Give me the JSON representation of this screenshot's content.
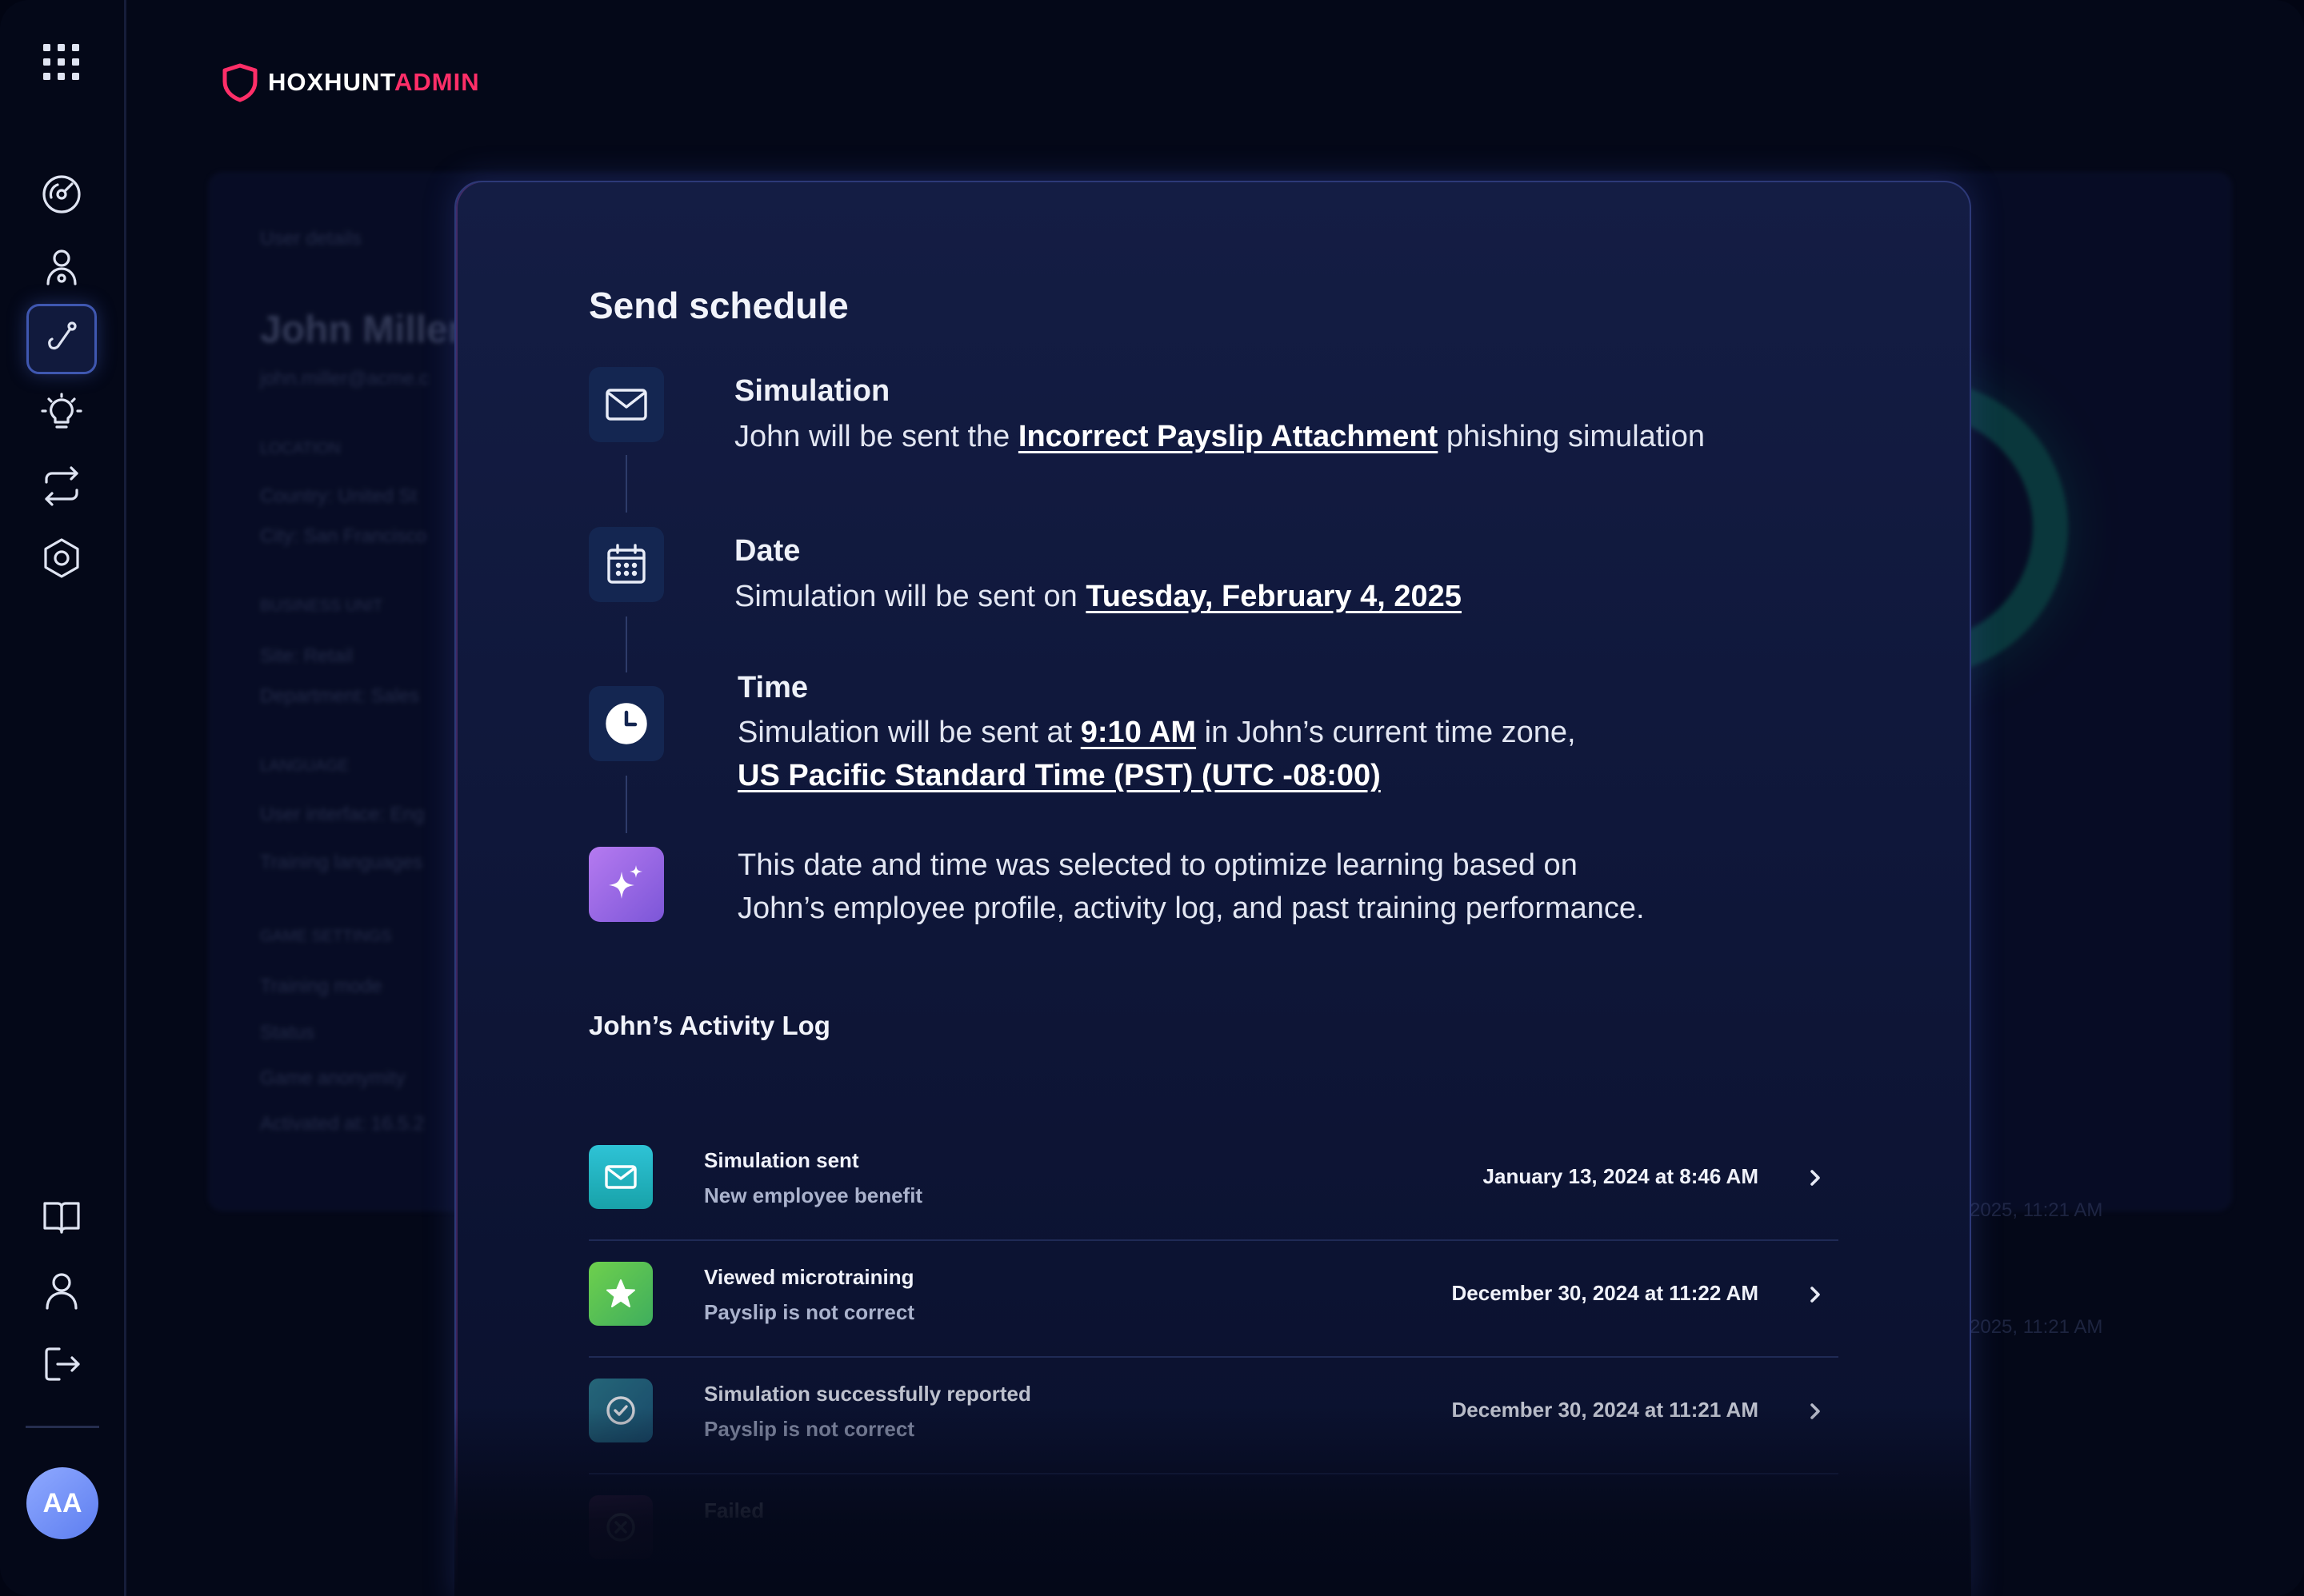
{
  "brand": {
    "name_part1": "HOXHUNT",
    "name_part2": "ADMIN",
    "accent": "#ff2e68"
  },
  "sidebar": {
    "icons": [
      "apps-grid-icon",
      "dashboard-icon",
      "user-settings-icon",
      "phishing-hook-icon",
      "lightbulb-icon",
      "sync-icon",
      "settings-hex-icon",
      "book-icon",
      "profile-icon",
      "logout-icon"
    ],
    "active": "phishing-hook-icon",
    "avatar_initials": "AA"
  },
  "background": {
    "section_label": "User details",
    "user_name": "John Miller",
    "user_email": "john.miller@acme.c",
    "location_label": "LOCATION",
    "country": "Country:  United St",
    "city": "City:  San Francisco",
    "business_label": "BUSINESS UNIT",
    "site": "Site:  Retail",
    "department": "Department:  Sales",
    "language_label": "LANGUAGE",
    "ui_language": "User interface:  Eng",
    "training_languages": "Training languages",
    "game_label": "GAME SETTINGS",
    "training_mode": "Training mode",
    "status": "Status",
    "game_anonymity": "Game anonymity",
    "activated": "Activated at:  16.5.2",
    "right_row1": "2025, 11:21 AM",
    "right_row2": "2025, 11:21 AM"
  },
  "modal": {
    "title": "Send schedule",
    "steps": {
      "simulation": {
        "heading": "Simulation",
        "text_pre": "John will be sent the ",
        "highlight": "Incorrect Payslip Attachment",
        "text_post": " phishing simulation"
      },
      "date": {
        "heading": "Date",
        "text_pre": "Simulation will be sent on ",
        "highlight": "Tuesday, February 4, 2025"
      },
      "time": {
        "heading": "Time",
        "text_pre": "Simulation will be sent at ",
        "highlight_time": "9:10 AM",
        "text_mid": " in John’s current time zone,",
        "highlight_zone": "US Pacific Standard Time (PST) (UTC -08:00)"
      },
      "ai_note": {
        "line1": "This date and time was selected to optimize learning based on",
        "line2": "John’s employee profile, activity log, and past training performance."
      }
    },
    "activity_log": {
      "title": "John’s Activity Log",
      "rows": [
        {
          "name": "Simulation sent",
          "sub": "New employee benefit",
          "date": "January 13, 2024 at 8:46 AM",
          "icon": "mail-icon",
          "color": "#22b3c5"
        },
        {
          "name": "Viewed microtraining",
          "sub": "Payslip is not correct",
          "date": "December 30, 2024 at 11:22 AM",
          "icon": "star-icon",
          "color": "#5cc34e"
        },
        {
          "name": "Simulation successfully reported",
          "sub": "Payslip is not correct",
          "date": "December 30, 2024 at 11:21 AM",
          "icon": "check-circle-icon",
          "color": "#2b6e8c"
        },
        {
          "name": "Failed",
          "sub": "",
          "date": "",
          "icon": "x-circle-icon",
          "color": "#5a2a55"
        }
      ]
    }
  }
}
